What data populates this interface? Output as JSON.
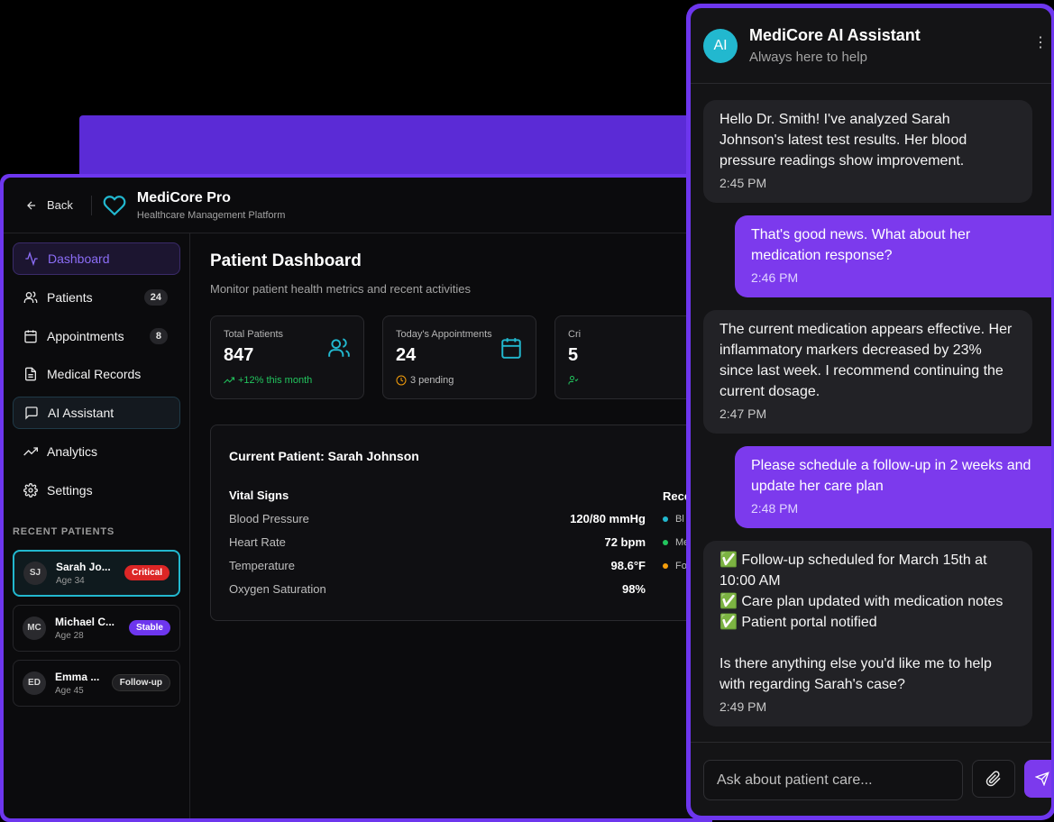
{
  "dashboard": {
    "back_label": "Back",
    "brand": {
      "title": "MediCore Pro",
      "subtitle": "Healthcare Management Platform"
    },
    "nav": [
      {
        "label": "Dashboard",
        "badge": ""
      },
      {
        "label": "Patients",
        "badge": "24"
      },
      {
        "label": "Appointments",
        "badge": "8"
      },
      {
        "label": "Medical Records",
        "badge": ""
      },
      {
        "label": "AI Assistant",
        "badge": ""
      },
      {
        "label": "Analytics",
        "badge": ""
      },
      {
        "label": "Settings",
        "badge": ""
      }
    ],
    "recent_label": "RECENT PATIENTS",
    "recent": [
      {
        "initials": "SJ",
        "name": "Sarah Jo...",
        "age": "Age 34",
        "status": "Critical"
      },
      {
        "initials": "MC",
        "name": "Michael C...",
        "age": "Age 28",
        "status": "Stable"
      },
      {
        "initials": "ED",
        "name": "Emma ...",
        "age": "Age 45",
        "status": "Follow-up"
      }
    ],
    "page_title": "Patient Dashboard",
    "page_subtitle": "Monitor patient health metrics and recent activities",
    "stats": [
      {
        "label": "Total Patients",
        "value": "847",
        "note": "+12% this month"
      },
      {
        "label": "Today's Appointments",
        "value": "24",
        "note": "3 pending"
      },
      {
        "label": "Cri",
        "value": "5",
        "note": ""
      }
    ],
    "current_patient": {
      "title": "Current Patient: Sarah Johnson",
      "vitals_heading": "Vital Signs",
      "vitals": [
        {
          "k": "Blood Pressure",
          "v": "120/80 mmHg"
        },
        {
          "k": "Heart Rate",
          "v": "72 bpm"
        },
        {
          "k": "Temperature",
          "v": "98.6°F"
        },
        {
          "k": "Oxygen Saturation",
          "v": "98%"
        }
      ],
      "recent_heading": "Rece",
      "recent_items": [
        "Bl",
        "Me",
        "Fo"
      ]
    }
  },
  "chat": {
    "avatar": "AI",
    "title": "MediCore AI Assistant",
    "subtitle": "Always here to help",
    "messages": [
      {
        "from": "ai",
        "text": "Hello Dr. Smith! I've analyzed Sarah Johnson's latest test results. Her blood pressure readings show improvement.",
        "time": "2:45 PM"
      },
      {
        "from": "user",
        "text": "That's good news. What about her medication response?",
        "time": "2:46 PM"
      },
      {
        "from": "ai",
        "text": "The current medication appears effective. Her inflammatory markers decreased by 23% since last week. I recommend continuing the current dosage.",
        "time": "2:47 PM"
      },
      {
        "from": "user",
        "text": "Please schedule a follow-up in 2 weeks and update her care plan",
        "time": "2:48 PM"
      },
      {
        "from": "ai",
        "lines": [
          "✅ Follow-up scheduled for March 15th at 10:00 AM",
          "✅ Care plan updated with medication notes",
          "✅ Patient portal notified",
          "",
          "Is there anything else you'd like me to help with regarding Sarah's case?"
        ],
        "time": "2:49 PM"
      }
    ],
    "input_placeholder": "Ask about patient care..."
  },
  "colors": {
    "accent": "#6d36ee",
    "teal": "#22b8cf",
    "critical": "#dc2626",
    "success": "#22c55e",
    "warning": "#f59e0b"
  }
}
